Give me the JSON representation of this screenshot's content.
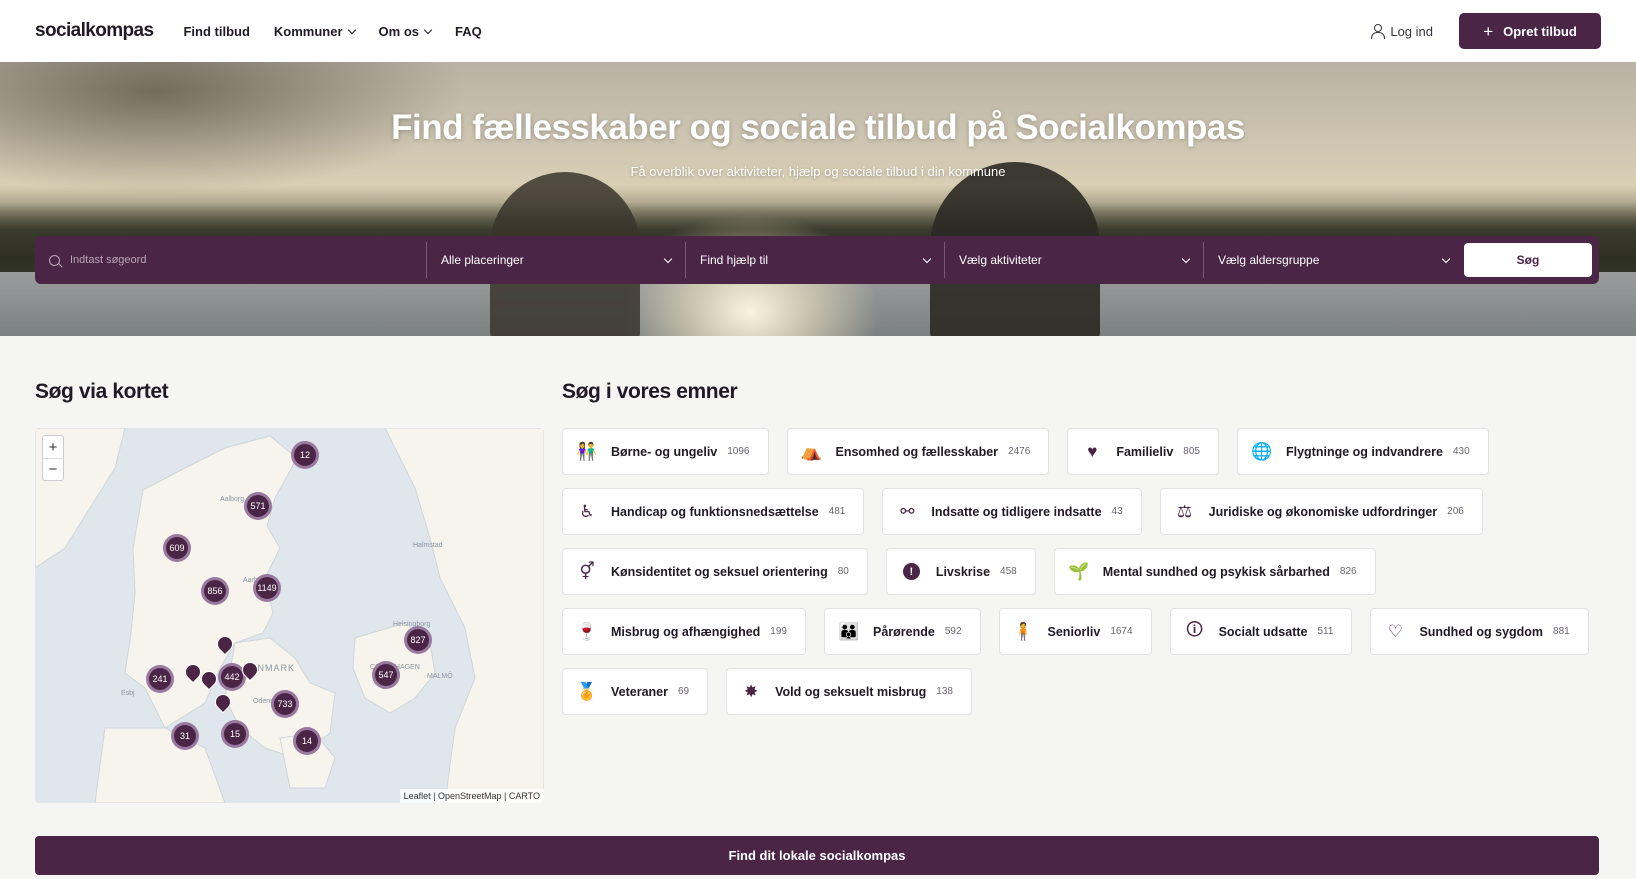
{
  "header": {
    "logo": "socialkompas",
    "nav": [
      "Find tilbud",
      "Kommuner",
      "Om os",
      "FAQ"
    ],
    "login": "Log ind",
    "create": "Opret tilbud"
  },
  "hero": {
    "title": "Find fællesskaber og sociale tilbud på Socialkompas",
    "subtitle": "Få overblik over aktiviteter, hjælp og sociale tilbud i din kommune",
    "search_placeholder": "Indtast søgeord",
    "location": "Alle placeringer",
    "help": "Find hjælp til",
    "activities": "Vælg aktiviteter",
    "age": "Vælg aldersgruppe",
    "search_button": "Søg"
  },
  "map_section": {
    "title": "Søg via kortet",
    "zoom_in": "+",
    "zoom_out": "−",
    "attribution": "Leaflet | OpenStreetMap | CARTO",
    "places": [
      "Aalborg",
      "Halmstad",
      "Aarhus",
      "Helsingborg",
      "DENMARK",
      "COPENHAGEN",
      "MALMÖ",
      "Odense",
      "Esbj"
    ],
    "clusters": [
      "12",
      "571",
      "609",
      "856",
      "1149",
      "827",
      "547",
      "241",
      "442",
      "733",
      "31",
      "15",
      "14"
    ]
  },
  "topics_section": {
    "title": "Søg i vores emner",
    "rows": [
      [
        {
          "label": "Børne- og ungeliv",
          "count": "1096",
          "icon": "children-icon"
        },
        {
          "label": "Ensomhed og fællesskaber",
          "count": "2476",
          "icon": "community-icon"
        },
        {
          "label": "Familieliv",
          "count": "805",
          "icon": "heart-icon"
        },
        {
          "label": "Flygtninge og indvandrere",
          "count": "430",
          "icon": "globe-icon"
        }
      ],
      [
        {
          "label": "Handicap og funktionsnedsættelse",
          "count": "481",
          "icon": "wheelchair-icon"
        },
        {
          "label": "Indsatte og tidligere indsatte",
          "count": "43",
          "icon": "handcuffs-icon"
        },
        {
          "label": "Juridiske og økonomiske udfordringer",
          "count": "206",
          "icon": "scales-icon"
        }
      ],
      [
        {
          "label": "Kønsidentitet og seksuel orientering",
          "count": "80",
          "icon": "gender-icon"
        },
        {
          "label": "Livskrise",
          "count": "458",
          "icon": "alert-icon"
        },
        {
          "label": "Mental sundhed og psykisk sårbarhed",
          "count": "826",
          "icon": "sprout-icon"
        }
      ],
      [
        {
          "label": "Misbrug og afhængighed",
          "count": "199",
          "icon": "glass-icon"
        },
        {
          "label": "Pårørende",
          "count": "592",
          "icon": "group-icon"
        },
        {
          "label": "Seniorliv",
          "count": "1674",
          "icon": "senior-icon"
        },
        {
          "label": "Socialt udsatte",
          "count": "511",
          "icon": "person-alert-icon"
        },
        {
          "label": "Sundhed og sygdom",
          "count": "881",
          "icon": "heartbeat-icon"
        }
      ],
      [
        {
          "label": "Veteraner",
          "count": "69",
          "icon": "medal-icon"
        },
        {
          "label": "Vold og seksuelt misbrug",
          "count": "138",
          "icon": "burst-icon"
        }
      ]
    ]
  },
  "cta": "Find dit lokale socialkompas",
  "colors": {
    "brand": "#4a2546",
    "background": "#f5f5f4"
  }
}
